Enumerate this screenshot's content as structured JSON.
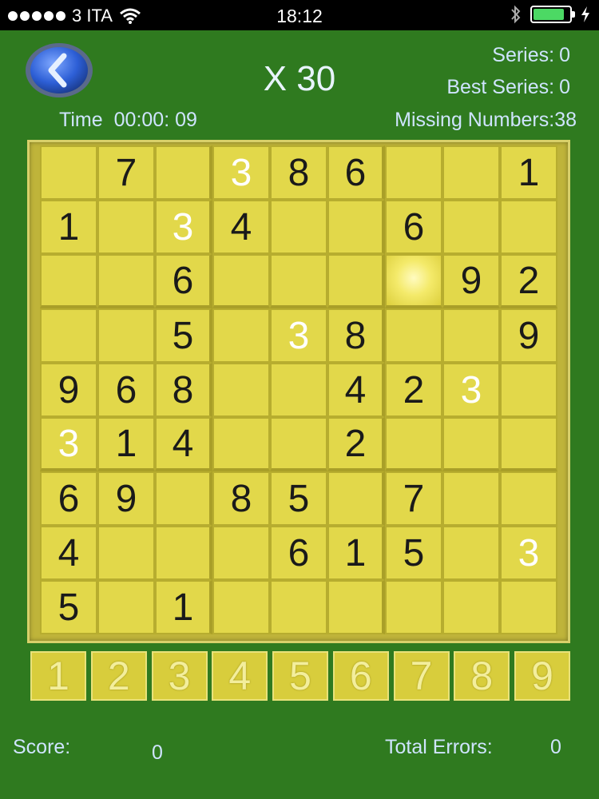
{
  "status_bar": {
    "carrier": "3 ITA",
    "time": "18:12",
    "signal_bars": 5,
    "battery_level": 0.8
  },
  "header": {
    "multiplier": "X 30",
    "series_label": "Series:",
    "series_value": "0",
    "best_series_label": "Best Series:",
    "best_series_value": "0",
    "time_label": "Time",
    "time_value": "00:00: 09",
    "missing_label": "Missing Numbers:",
    "missing_value": "38"
  },
  "board": {
    "rows": [
      [
        "",
        "7",
        "",
        "3",
        "8",
        "6",
        "",
        "",
        "1"
      ],
      [
        "1",
        "",
        "3",
        "4",
        "",
        "",
        "6",
        "",
        ""
      ],
      [
        "",
        "",
        "6",
        "",
        "",
        "",
        "",
        "9",
        "2"
      ],
      [
        "",
        "",
        "5",
        "",
        "3",
        "8",
        "",
        "",
        "9"
      ],
      [
        "9",
        "6",
        "8",
        "",
        "",
        "4",
        "2",
        "3",
        ""
      ],
      [
        "3",
        "1",
        "4",
        "",
        "",
        "2",
        "",
        "",
        ""
      ],
      [
        "6",
        "9",
        "",
        "8",
        "5",
        "",
        "7",
        "",
        ""
      ],
      [
        "4",
        "",
        "",
        "",
        "6",
        "1",
        "5",
        "",
        "3"
      ],
      [
        "5",
        "",
        "1",
        "",
        "",
        "",
        "",
        "",
        ""
      ]
    ],
    "highlighted_cells": [
      [
        0,
        3
      ],
      [
        1,
        2
      ],
      [
        3,
        4
      ],
      [
        4,
        7
      ],
      [
        5,
        0
      ],
      [
        7,
        8
      ]
    ],
    "selected_cell": [
      2,
      6
    ],
    "colors": {
      "cell": "#e2d84a",
      "given": "#1a1a1a",
      "highlight": "#ffffff"
    }
  },
  "number_pad": [
    "1",
    "2",
    "3",
    "4",
    "5",
    "6",
    "7",
    "8",
    "9"
  ],
  "footer": {
    "score_label": "Score:",
    "score_value": "0",
    "errors_label": "Total Errors:",
    "errors_value": "0"
  },
  "icons": {
    "back": "back-arrow-icon"
  }
}
